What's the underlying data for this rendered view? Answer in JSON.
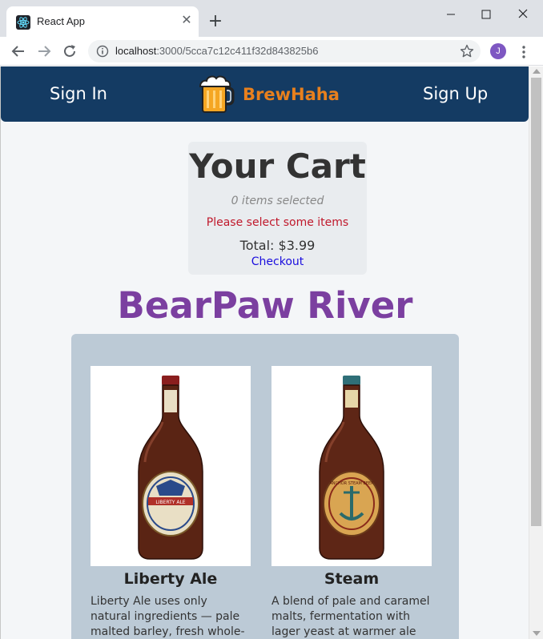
{
  "browser": {
    "tab_title": "React App",
    "url_host": "localhost",
    "url_rest": ":3000/5cca7c12c411f32d843825b6",
    "profile_initial": "J"
  },
  "navbar": {
    "sign_in": "Sign In",
    "brand": "BrewHaha",
    "sign_up": "Sign Up",
    "brand_color": "#e8801d",
    "bar_color": "#143b63"
  },
  "cart": {
    "title": "Your Cart",
    "count": "0 items selected",
    "warning": "Please select some items",
    "total": "Total: $3.99",
    "checkout": "Checkout"
  },
  "brewery": {
    "name": "BearPaw River",
    "color": "#7b3fa0"
  },
  "beers": [
    {
      "name": "Liberty Ale",
      "description": "Liberty Ale uses only natural ingredients — pale malted barley, fresh whole-cone",
      "label_color": "#e9dfc5",
      "label_text": "LIBERTY ALE"
    },
    {
      "name": "Steam",
      "description": "A blend of pale and caramel malts, fermentation with lager yeast at warmer ale",
      "label_color": "#d9a552",
      "label_text": "ANCHOR STEAM BEER"
    }
  ]
}
